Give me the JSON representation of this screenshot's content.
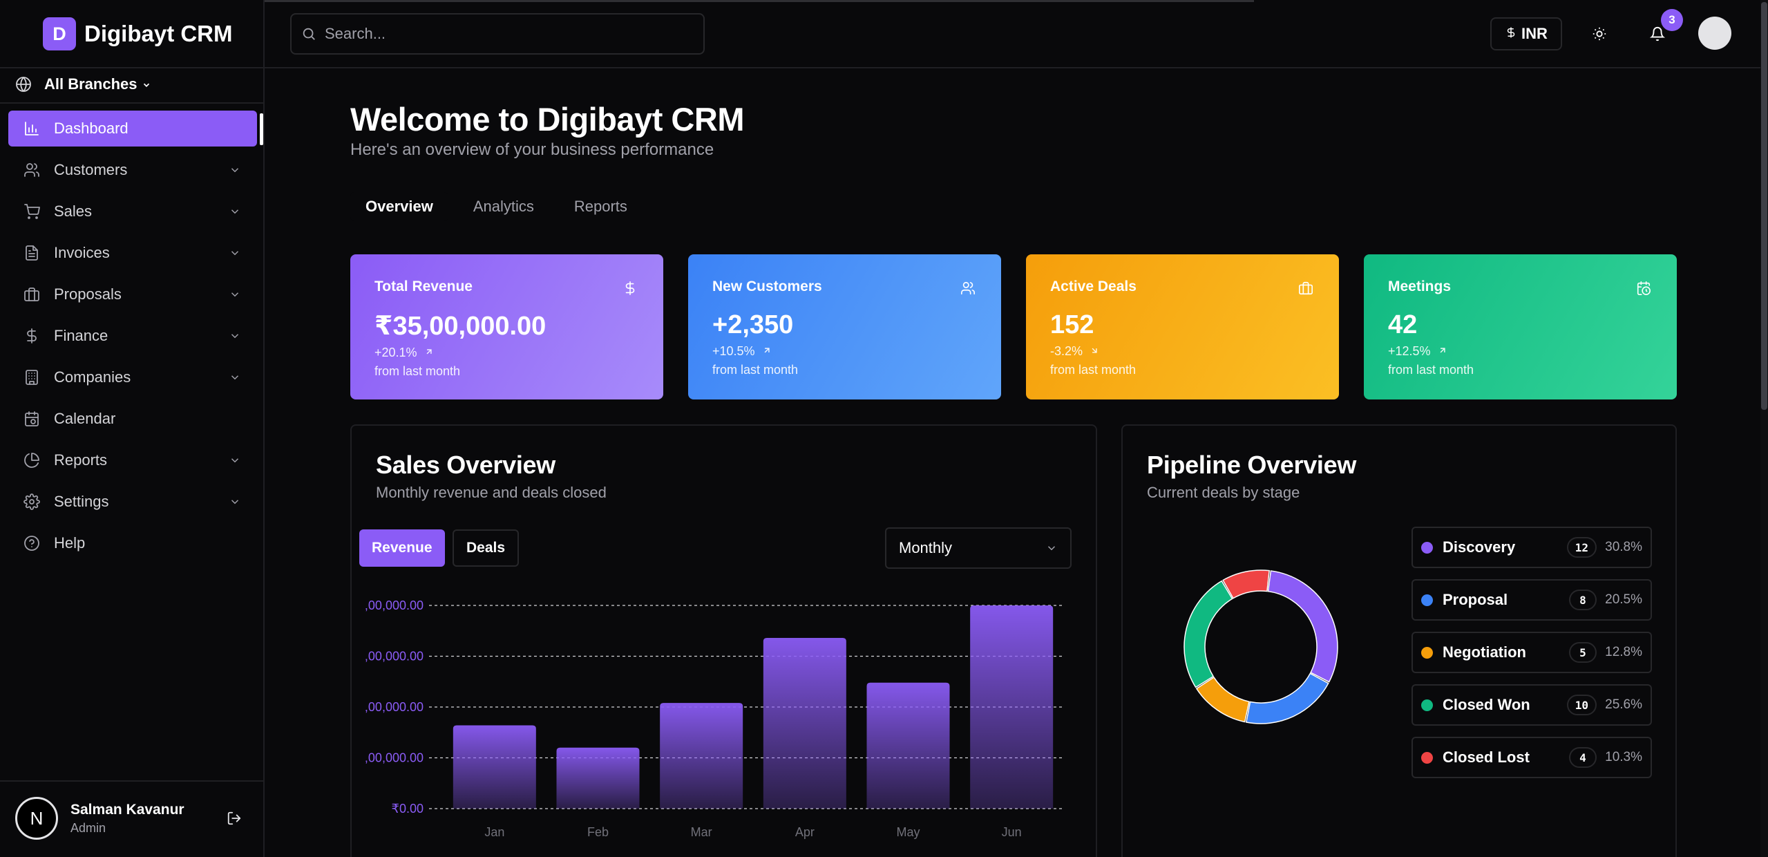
{
  "brand": {
    "logo_letter": "D",
    "name": "Digibayt CRM"
  },
  "branch_selector": {
    "label": "All Branches"
  },
  "nav": [
    {
      "label": "Dashboard",
      "icon": "bar-chart-icon",
      "active": true,
      "expandable": false
    },
    {
      "label": "Customers",
      "icon": "users-icon",
      "expandable": true
    },
    {
      "label": "Sales",
      "icon": "cart-icon",
      "expandable": true
    },
    {
      "label": "Invoices",
      "icon": "file-text-icon",
      "expandable": true
    },
    {
      "label": "Proposals",
      "icon": "briefcase-icon",
      "expandable": true
    },
    {
      "label": "Finance",
      "icon": "dollar-icon",
      "expandable": true
    },
    {
      "label": "Companies",
      "icon": "building-icon",
      "expandable": true
    },
    {
      "label": "Calendar",
      "icon": "calendar-icon",
      "expandable": false
    },
    {
      "label": "Reports",
      "icon": "pie-chart-icon",
      "expandable": true
    },
    {
      "label": "Settings",
      "icon": "gear-icon",
      "expandable": true
    },
    {
      "label": "Help",
      "icon": "help-circle-icon",
      "expandable": false
    }
  ],
  "user": {
    "initial": "N",
    "name": "Salman Kavanur",
    "role": "Admin"
  },
  "header": {
    "search_placeholder": "Search...",
    "currency": "INR",
    "notification_count": "3"
  },
  "page": {
    "title": "Welcome to Digibayt CRM",
    "subtitle": "Here's an overview of your business performance",
    "tabs": [
      "Overview",
      "Analytics",
      "Reports"
    ],
    "active_tab": "Overview"
  },
  "stat_cards": [
    {
      "title": "Total Revenue",
      "value": "₹35,00,000.00",
      "change": "+20.1%",
      "direction": "up",
      "sub": "from last month",
      "icon": "dollar-icon",
      "color": "#8b5cf6"
    },
    {
      "title": "New Customers",
      "value": "+2,350",
      "change": "+10.5%",
      "direction": "up",
      "sub": "from last month",
      "icon": "users-icon",
      "color": "#3b82f6"
    },
    {
      "title": "Active Deals",
      "value": "152",
      "change": "-3.2%",
      "direction": "down",
      "sub": "from last month",
      "icon": "briefcase-icon",
      "color": "#f59e0b"
    },
    {
      "title": "Meetings",
      "value": "42",
      "change": "+12.5%",
      "direction": "up",
      "sub": "from last month",
      "icon": "calendar-clock-icon",
      "color": "#10b981"
    }
  ],
  "sales_overview": {
    "title": "Sales Overview",
    "subtitle": "Monthly revenue and deals closed",
    "toggles": [
      "Revenue",
      "Deals"
    ],
    "active_toggle": "Revenue",
    "period": "Monthly"
  },
  "pipeline_overview": {
    "title": "Pipeline Overview",
    "subtitle": "Current deals by stage",
    "stages": [
      {
        "name": "Discovery",
        "count": "12",
        "percent": "30.8%",
        "value": 30.8,
        "color": "#8b5cf6"
      },
      {
        "name": "Proposal",
        "count": "8",
        "percent": "20.5%",
        "value": 20.5,
        "color": "#3b82f6"
      },
      {
        "name": "Negotiation",
        "count": "5",
        "percent": "12.8%",
        "value": 12.8,
        "color": "#f59e0b"
      },
      {
        "name": "Closed Won",
        "count": "10",
        "percent": "25.6%",
        "value": 25.6,
        "color": "#10b981"
      },
      {
        "name": "Closed Lost",
        "count": "4",
        "percent": "10.3%",
        "value": 10.3,
        "color": "#ef4444"
      }
    ]
  },
  "chart_data": {
    "type": "bar",
    "categories": [
      "Jan",
      "Feb",
      "Mar",
      "Apr",
      "May",
      "Jun"
    ],
    "values": [
      410000,
      300000,
      520000,
      840000,
      620000,
      1000000
    ],
    "ylim": [
      0,
      1000000
    ],
    "ytick_labels": [
      "₹0.00",
      ",00,000.00",
      ",00,000.00",
      ",00,000.00",
      ",00,000.00"
    ],
    "grid": true,
    "bar_color": "#8b5cf6",
    "title": "",
    "xlabel": "",
    "ylabel": ""
  }
}
